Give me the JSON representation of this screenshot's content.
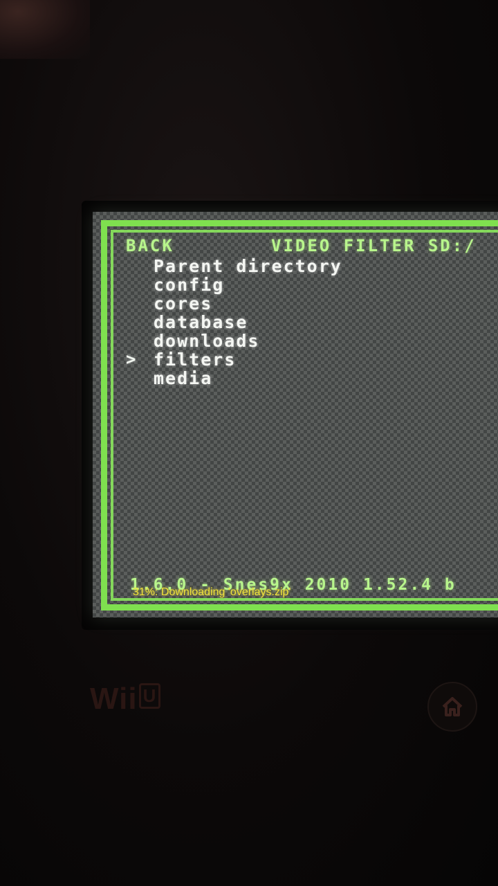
{
  "header": {
    "back_label": "BACK",
    "title": "VIDEO FILTER SD:/"
  },
  "menu": {
    "cursor_glyph": ">",
    "selected_index": 5,
    "items": [
      {
        "label": "Parent directory"
      },
      {
        "label": "config"
      },
      {
        "label": "cores"
      },
      {
        "label": "database"
      },
      {
        "label": "downloads"
      },
      {
        "label": "filters"
      },
      {
        "label": "media"
      }
    ]
  },
  "footer": {
    "core_info": "1.6.0 - Snes9x 2010 1.52.4 b"
  },
  "notification": {
    "text": "31%: Downloading 'overlays.zip'",
    "progress_percent": 31
  },
  "device": {
    "brand": "Wii",
    "brand_badge": "U",
    "home_icon": "home-icon"
  },
  "colors": {
    "frame_green": "#7fe04f",
    "header_green": "#b8f58c",
    "item_white": "#f4f6f2",
    "notify_yellow": "#f0e23a"
  }
}
